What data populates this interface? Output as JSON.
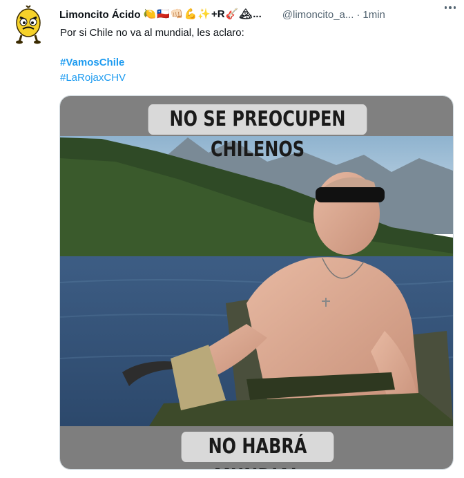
{
  "tweet": {
    "author_name": "Limoncito Ácido",
    "author_emojis": [
      "🍋",
      "🇨🇱",
      "👊🏻",
      "💪",
      "✨",
      "+R",
      "🎸",
      "🏔",
      "..."
    ],
    "handle": "@limoncito_a...",
    "separator": "·",
    "time": "1min",
    "text": "Por si Chile no va al mundial, les aclaro:",
    "hashtags": [
      "#VamosChile",
      "#LaRojaxCHV"
    ],
    "media": {
      "caption_top": "NO SE PREOCUPEN CHILENOS",
      "caption_bottom": "NO HABRÁ MUNDIAL"
    },
    "icons": {
      "avatar": "cartoon-lemon-avatar",
      "more": "more-options-icon"
    }
  },
  "colors": {
    "link": "#1d9bf0",
    "muted": "#536471",
    "text": "#0f1419",
    "avatar_yellow": "#f6d22a"
  }
}
